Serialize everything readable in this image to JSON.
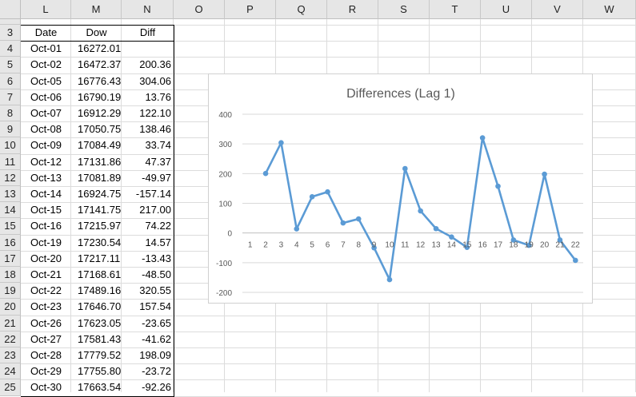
{
  "columns": [
    "L",
    "M",
    "N",
    "O",
    "P",
    "Q",
    "R",
    "S",
    "T",
    "U",
    "V",
    "W"
  ],
  "rows": [
    "3",
    "4",
    "5",
    "6",
    "7",
    "8",
    "9",
    "10",
    "11",
    "12",
    "13",
    "14",
    "15",
    "16",
    "17",
    "18",
    "19",
    "20",
    "21",
    "22",
    "23",
    "24",
    "25"
  ],
  "table": {
    "headers": [
      "Date",
      "Dow",
      "Diff"
    ],
    "data": [
      [
        "Oct-01",
        "16272.01",
        ""
      ],
      [
        "Oct-02",
        "16472.37",
        "200.36"
      ],
      [
        "Oct-05",
        "16776.43",
        "304.06"
      ],
      [
        "Oct-06",
        "16790.19",
        "13.76"
      ],
      [
        "Oct-07",
        "16912.29",
        "122.10"
      ],
      [
        "Oct-08",
        "17050.75",
        "138.46"
      ],
      [
        "Oct-09",
        "17084.49",
        "33.74"
      ],
      [
        "Oct-12",
        "17131.86",
        "47.37"
      ],
      [
        "Oct-13",
        "17081.89",
        "-49.97"
      ],
      [
        "Oct-14",
        "16924.75",
        "-157.14"
      ],
      [
        "Oct-15",
        "17141.75",
        "217.00"
      ],
      [
        "Oct-16",
        "17215.97",
        "74.22"
      ],
      [
        "Oct-19",
        "17230.54",
        "14.57"
      ],
      [
        "Oct-20",
        "17217.11",
        "-13.43"
      ],
      [
        "Oct-21",
        "17168.61",
        "-48.50"
      ],
      [
        "Oct-22",
        "17489.16",
        "320.55"
      ],
      [
        "Oct-23",
        "17646.70",
        "157.54"
      ],
      [
        "Oct-26",
        "17623.05",
        "-23.65"
      ],
      [
        "Oct-27",
        "17581.43",
        "-41.62"
      ],
      [
        "Oct-28",
        "17779.52",
        "198.09"
      ],
      [
        "Oct-29",
        "17755.80",
        "-23.72"
      ],
      [
        "Oct-30",
        "17663.54",
        "-92.26"
      ]
    ]
  },
  "chart_data": {
    "type": "line",
    "title": "Differences (Lag 1)",
    "xlabel": "",
    "ylabel": "",
    "ylim": [
      -200,
      400
    ],
    "yticks": [
      "400",
      "300",
      "200",
      "100",
      "0",
      "-100",
      "-200"
    ],
    "x": [
      "1",
      "2",
      "3",
      "4",
      "5",
      "6",
      "7",
      "8",
      "9",
      "10",
      "11",
      "12",
      "13",
      "14",
      "15",
      "16",
      "17",
      "18",
      "19",
      "20",
      "21",
      "22"
    ],
    "values": [
      null,
      200.36,
      304.06,
      13.76,
      122.1,
      138.46,
      33.74,
      47.37,
      -49.97,
      -157.14,
      217.0,
      74.22,
      14.57,
      -13.43,
      -48.5,
      320.55,
      157.54,
      -23.65,
      -41.62,
      198.09,
      -23.72,
      -92.26
    ],
    "grid": true,
    "legend": "none",
    "color": "#5b9bd5"
  }
}
